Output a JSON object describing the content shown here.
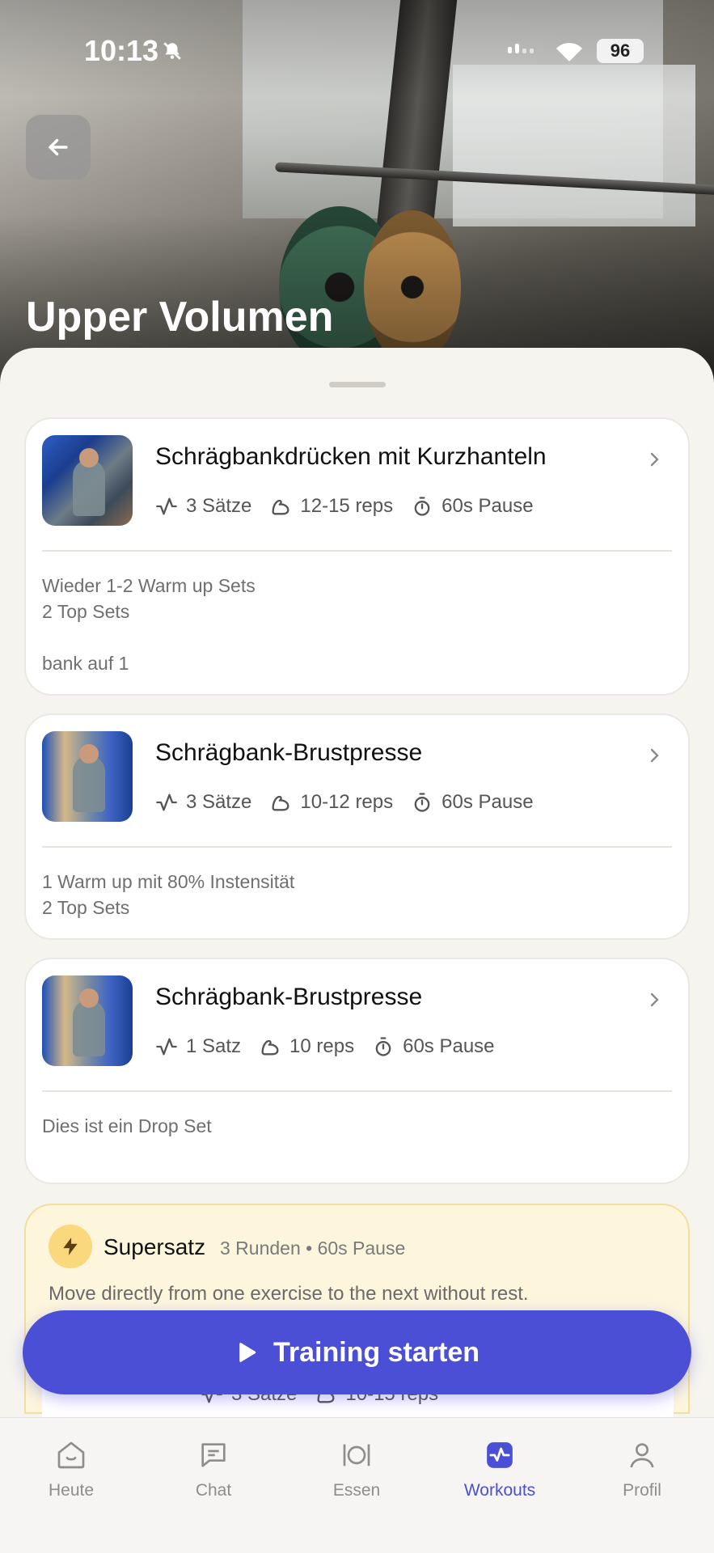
{
  "status_bar": {
    "time": "10:13",
    "battery": "96"
  },
  "header": {
    "title": "Upper Volumen"
  },
  "exercises": [
    {
      "name": "Schrägbankdrücken mit Kurzhanteln",
      "sets": "3 Sätze",
      "reps": "12-15 reps",
      "rest": "60s Pause",
      "notes": [
        "Wieder 1-2 Warm up Sets",
        "2 Top Sets",
        "",
        "bank auf 1"
      ]
    },
    {
      "name": "Schrägbank-Brustpresse",
      "sets": "3 Sätze",
      "reps": "10-12 reps",
      "rest": "60s Pause",
      "notes": [
        "1 Warm up mit 80% Instensität",
        "2 Top Sets"
      ]
    },
    {
      "name": "Schrägbank-Brustpresse",
      "sets": "1 Satz",
      "reps": "10 reps",
      "rest": "60s Pause",
      "notes": [
        "Dies ist ein Drop Set"
      ]
    }
  ],
  "superset": {
    "title": "Supersatz",
    "meta": "3 Runden • 60s Pause",
    "description": "Move directly from one exercise to the next without rest.",
    "first_item": {
      "sets": "3 Sätze",
      "reps": "10-15 reps"
    }
  },
  "start_button": {
    "label": "Training starten"
  },
  "tabs": [
    {
      "label": "Heute",
      "icon": "home-icon"
    },
    {
      "label": "Chat",
      "icon": "chat-icon"
    },
    {
      "label": "Essen",
      "icon": "plate-icon"
    },
    {
      "label": "Workouts",
      "icon": "workouts-icon"
    },
    {
      "label": "Profil",
      "icon": "profile-icon"
    }
  ],
  "colors": {
    "accent": "#4b4fd6",
    "superset_bg": "#fdf5dc",
    "bolt_bg": "#f9d87e"
  }
}
